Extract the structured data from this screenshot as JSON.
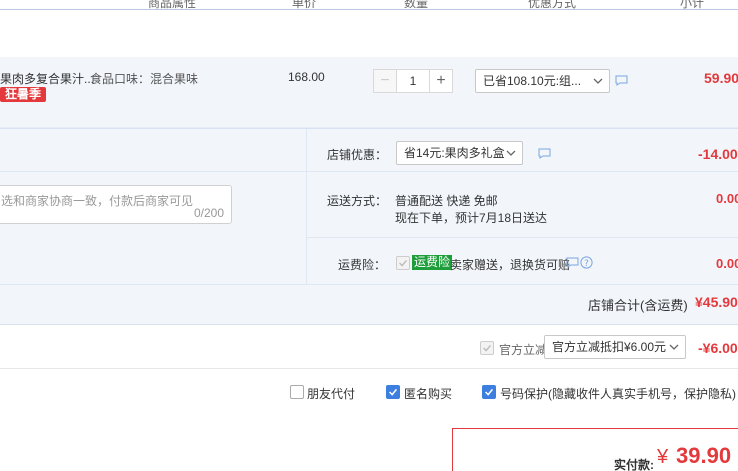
{
  "header": {
    "col_attrs": "商品属性",
    "col_price": "单价",
    "col_qty": "数量",
    "col_discount": "优惠方式",
    "col_subtotal": "小计"
  },
  "item": {
    "title": "果肉多复合果汁...",
    "attr": "食品口味：混合果味",
    "promo_tag": "狂暑季",
    "price": "168.00",
    "quantity": "1",
    "discount_select": "已省108.10元:组...",
    "subtotal": "59.90"
  },
  "shop": {
    "coupon_label": "店铺优惠：",
    "coupon_select": "省14元:果肉多礼盒",
    "coupon_amount": "-14.00",
    "message_placeholder": "选和商家协商一致，付款后商家可见",
    "message_count": "0/200",
    "shipping_label": "运送方式：",
    "shipping_method": "普通配送 快递 免邮",
    "shipping_eta": "现在下单，预计7月18日送达",
    "shipping_amount": "0.00",
    "insurance_label": "运费险：",
    "insurance_tag": "运费险",
    "insurance_desc": "卖家赠送，退换货可赔",
    "insurance_amount": "0.00",
    "total_label": "店铺合计(含运费)",
    "total_amount": "¥45.90"
  },
  "official": {
    "label": "官方立减",
    "select": "官方立减抵扣¥6.00元",
    "amount": "-¥6.00"
  },
  "options": {
    "friend_pay": "朋友代付",
    "anonymous": "匿名购买",
    "number_protect": "号码保护",
    "number_protect_desc": "(隐藏收件人真实手机号，保护隐私)"
  },
  "payment": {
    "label": "实付款:",
    "currency": "¥",
    "amount": "39.90"
  },
  "colors": {
    "accent_red": "#e4393c",
    "check_blue": "#3c7fe0",
    "panel_bg": "#f2f6fb",
    "insurance_green": "#1e9e3a"
  }
}
